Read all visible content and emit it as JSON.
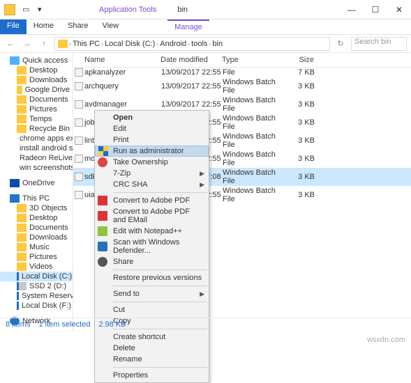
{
  "titlebar": {
    "app_label": "Application Tools",
    "title": "bin"
  },
  "ribbon": {
    "file": "File",
    "home": "Home",
    "share": "Share",
    "view": "View",
    "manage": "Manage"
  },
  "address": {
    "crumbs": [
      "This PC",
      "Local Disk (C:)",
      "Android",
      "tools",
      "bin"
    ],
    "search_placeholder": "Search bin"
  },
  "tree": {
    "quick": "Quick access",
    "quick_items": [
      "Desktop",
      "Downloads",
      "Google Drive",
      "Documents",
      "Pictures",
      "Temps",
      "Recycle Bin",
      "chrome apps extens",
      "install android sdk",
      "Radeon ReLive",
      "win screenshots"
    ],
    "onedrive": "OneDrive",
    "thispc": "This PC",
    "pc_items": [
      "3D Objects",
      "Desktop",
      "Documents",
      "Downloads",
      "Music",
      "Pictures",
      "Videos",
      "Local Disk (C:)",
      "SSD 2 (D:)",
      "System Reserved (E:)",
      "Local Disk (F:)"
    ],
    "network": "Network"
  },
  "cols": {
    "name": "Name",
    "date": "Date modified",
    "type": "Type",
    "size": "Size"
  },
  "files": [
    {
      "name": "apkanalyzer",
      "date": "13/09/2017 22:55",
      "type": "File",
      "size": "7 KB"
    },
    {
      "name": "archquery",
      "date": "13/09/2017 22:55",
      "type": "Windows Batch File",
      "size": "3 KB"
    },
    {
      "name": "avdmanager",
      "date": "13/09/2017 22:55",
      "type": "Windows Batch File",
      "size": "3 KB"
    },
    {
      "name": "jobb",
      "date": "13/09/2017 22:55",
      "type": "Windows Batch File",
      "size": "3 KB"
    },
    {
      "name": "lint",
      "date": "13/09/2017 22:55",
      "type": "Windows Batch File",
      "size": "3 KB"
    },
    {
      "name": "monkeyrunner",
      "date": "13/09/2017 22:55",
      "type": "Windows Batch File",
      "size": "3 KB"
    },
    {
      "name": "sdkmanager",
      "date": "15/02/2018 17:08",
      "type": "Windows Batch File",
      "size": "3 KB"
    },
    {
      "name": "uiautom",
      "date": "13/09/2017 22:55",
      "type": "Windows Batch File",
      "size": "3 KB"
    }
  ],
  "ctx": {
    "open": "Open",
    "edit": "Edit",
    "print": "Print",
    "runadmin": "Run as administrator",
    "take": "Take Ownership",
    "7zip": "7-Zip",
    "crcsha": "CRC SHA",
    "convpdf": "Convert to Adobe PDF",
    "convmail": "Convert to Adobe PDF and EMail",
    "editnpp": "Edit with Notepad++",
    "scandef": "Scan with Windows Defender...",
    "share": "Share",
    "restore": "Restore previous versions",
    "sendto": "Send to",
    "cut": "Cut",
    "copy": "Copy",
    "shortcut": "Create shortcut",
    "delete": "Delete",
    "rename": "Rename",
    "props": "Properties"
  },
  "status": {
    "items": "8 items",
    "selected": "1 item selected",
    "size": "2.98 KB"
  },
  "watermark": "wsxdn.com"
}
